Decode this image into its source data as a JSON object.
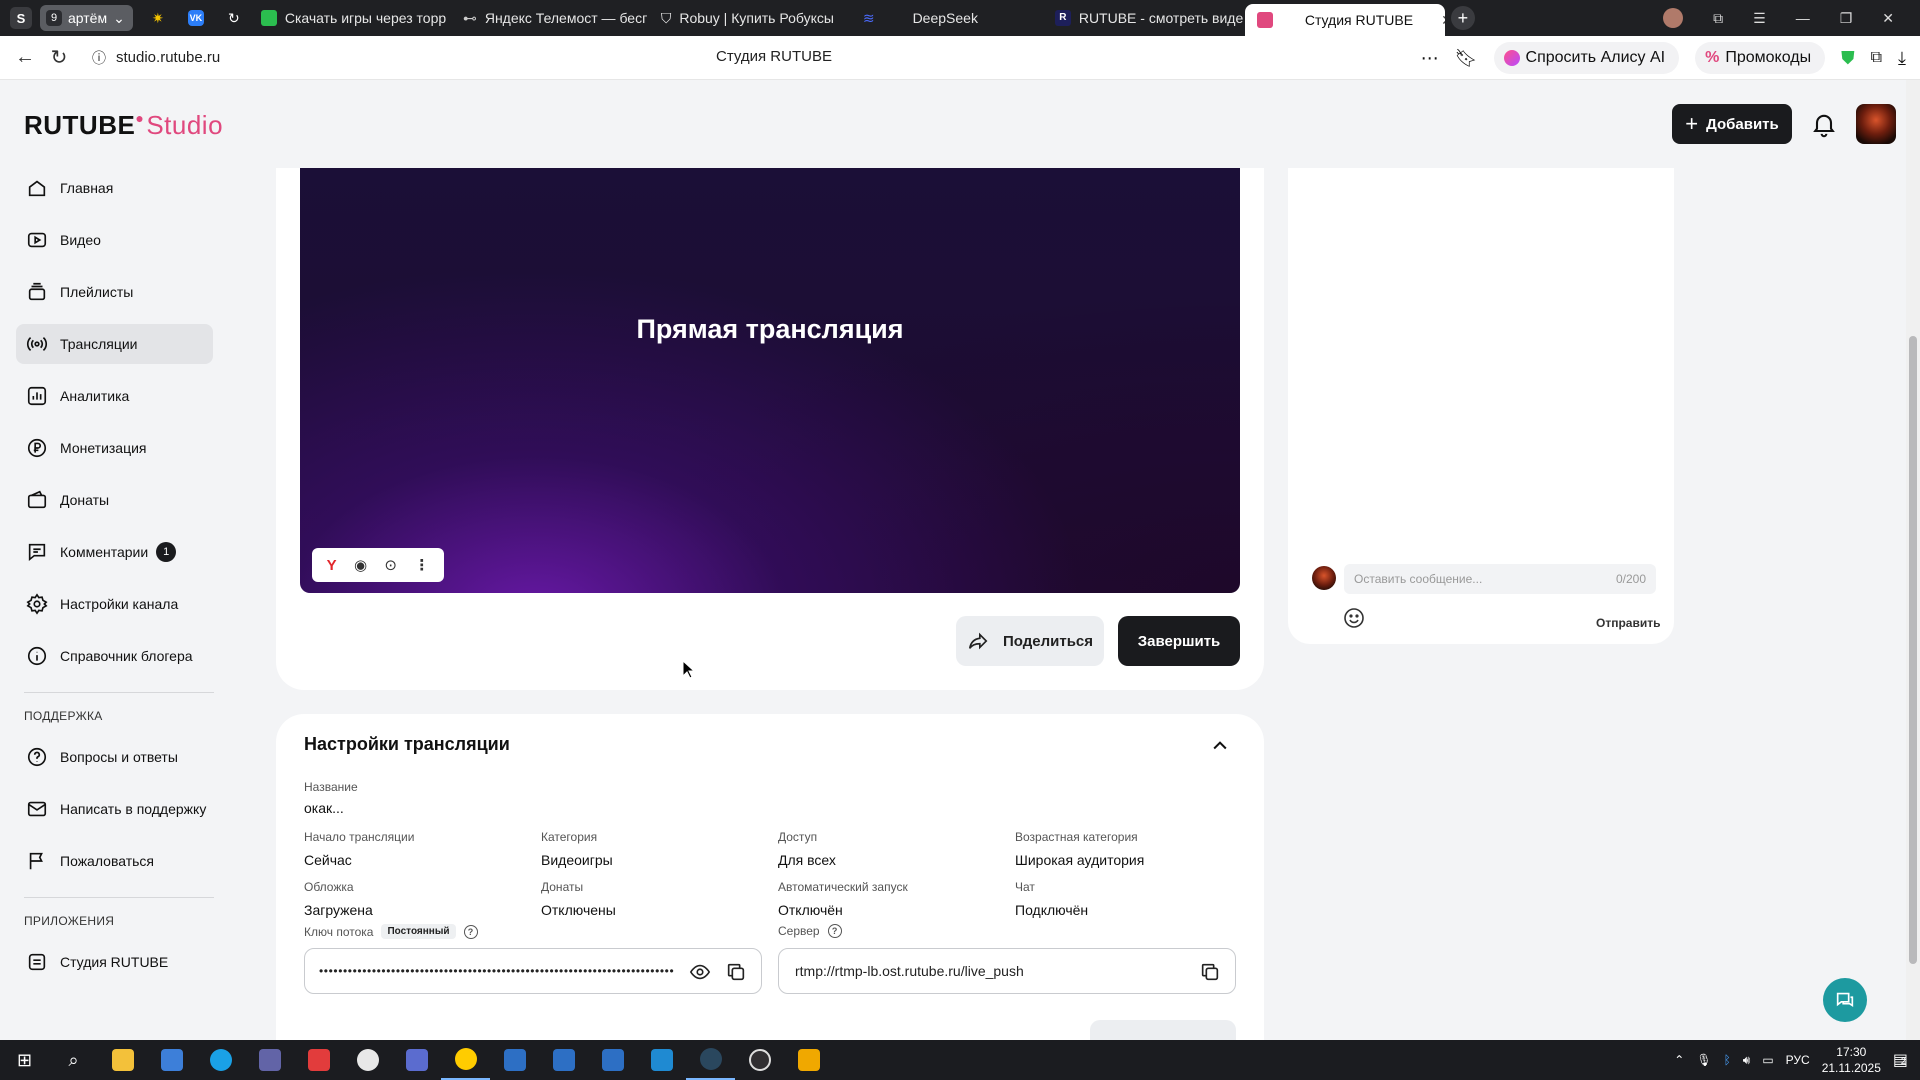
{
  "browser": {
    "profile_letter": "S",
    "group": {
      "count": "9",
      "name": "артём"
    },
    "tabs": [
      {
        "label": "Скачать игры через торр",
        "color": "#2bbd4f"
      },
      {
        "label": "Яндекс Телемост — бесп",
        "color": "#6a6a6a"
      },
      {
        "label": "Robuy | Купить Робуксы",
        "color": "#d03c4a"
      },
      {
        "label": "DeepSeek",
        "color": "#4b6bff"
      },
      {
        "label": "RUTUBE - смотреть виде",
        "color": "#1d1f5a"
      },
      {
        "label": "Студия RUTUBE",
        "color": "#e0487e"
      }
    ],
    "url": "studio.rutube.ru",
    "page_title": "Студия RUTUBE",
    "alice_label": "Спросить Алису AI",
    "promo_label": "Промокоды"
  },
  "header": {
    "logo_main": "RUTUBE",
    "logo_suffix": "Studio",
    "add_label": "Добавить"
  },
  "sidebar": {
    "items": [
      {
        "label": "Главная",
        "icon": "home-icon"
      },
      {
        "label": "Видео",
        "icon": "video-icon"
      },
      {
        "label": "Плейлисты",
        "icon": "playlist-icon"
      },
      {
        "label": "Трансляции",
        "icon": "broadcast-icon",
        "active": true
      },
      {
        "label": "Аналитика",
        "icon": "analytics-icon"
      },
      {
        "label": "Монетизация",
        "icon": "ruble-icon"
      },
      {
        "label": "Донаты",
        "icon": "wallet-icon"
      },
      {
        "label": "Комментарии",
        "icon": "comment-icon",
        "badge": "1"
      },
      {
        "label": "Настройки канала",
        "icon": "gear-icon"
      },
      {
        "label": "Справочник блогера",
        "icon": "info-icon"
      }
    ],
    "support_heading": "ПОДДЕРЖКА",
    "support_items": [
      {
        "label": "Вопросы и ответы",
        "icon": "question-icon"
      },
      {
        "label": "Написать в поддержку",
        "icon": "mail-icon"
      },
      {
        "label": "Пожаловаться",
        "icon": "flag-icon"
      }
    ],
    "apps_heading": "ПРИЛОЖЕНИЯ",
    "apps_items": [
      {
        "label": "Студия RUTUBE",
        "icon": "studio-icon"
      }
    ]
  },
  "stream": {
    "video_title": "Прямая трансляция",
    "share_label": "Поделиться",
    "finish_label": "Завершить"
  },
  "chat": {
    "placeholder": "Оставить сообщение...",
    "counter": "0/200",
    "send_label": "Отправить"
  },
  "settings": {
    "title": "Настройки трансляции",
    "name_label": "Название",
    "name_value": "окак...",
    "fields": [
      {
        "label": "Начало трансляции",
        "value": "Сейчас"
      },
      {
        "label": "Категория",
        "value": "Видеоигры"
      },
      {
        "label": "Доступ",
        "value": "Для всех"
      },
      {
        "label": "Возрастная категория",
        "value": "Широкая аудитория"
      },
      {
        "label": "Обложка",
        "value": "Загружена"
      },
      {
        "label": "Донаты",
        "value": "Отключены"
      },
      {
        "label": "Автоматический запуск",
        "value": "Отключён"
      },
      {
        "label": "Чат",
        "value": "Подключён"
      }
    ],
    "key_label": "Ключ потока",
    "key_tag": "Постоянный",
    "key_value": "••••••••••••••••••••••••••••••••••••••••••••••••••••••••••••••••••••••••••",
    "server_label": "Сервер",
    "server_value": "rtmp://rtmp-lb.ost.rutube.ru/live_push"
  },
  "taskbar": {
    "lang": "РУС",
    "time": "17:30",
    "date": "21.11.2025",
    "notif_count": "2"
  },
  "colors": {
    "accent": "#e0487e",
    "dark_button": "#1a1b1e",
    "help_fab": "#1d9aa0"
  }
}
